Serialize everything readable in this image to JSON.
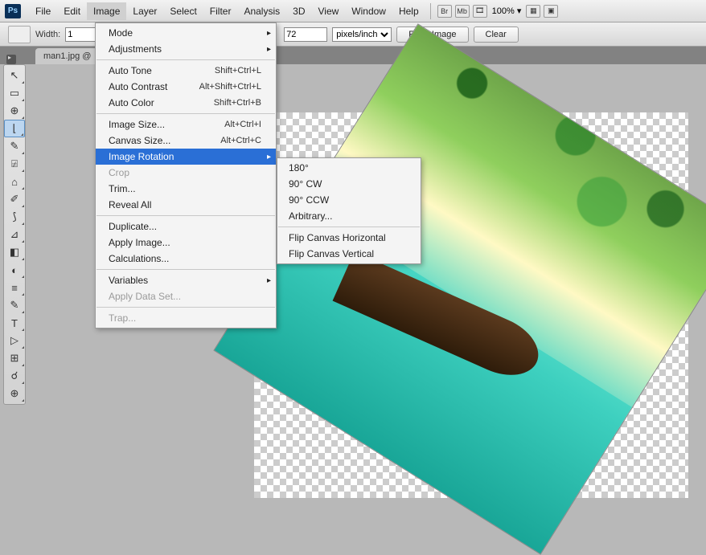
{
  "app": {
    "logo": "Ps"
  },
  "menubar": {
    "items": [
      "File",
      "Edit",
      "Image",
      "Layer",
      "Select",
      "Filter",
      "Analysis",
      "3D",
      "View",
      "Window",
      "Help"
    ],
    "active_index": 2,
    "extras": {
      "br": "Br",
      "mb": "Mb",
      "zoom": "100%  ▾"
    }
  },
  "optbar": {
    "width_label": "Width:",
    "width_value": "1",
    "res_value": "72",
    "res_unit": "pixels/inch",
    "front_image": "Front Image",
    "clear": "Clear"
  },
  "tab": {
    "label": "man1.jpg @"
  },
  "tools": {
    "items": [
      "↖",
      "▭",
      "⊕",
      "⌊",
      "✎",
      "⍯",
      "⌂",
      "✐",
      "⟆",
      "⊿",
      "◧",
      "◐",
      "≡",
      "✎",
      "T",
      "▷",
      "⊞",
      "☌",
      "⊕"
    ],
    "selected_index": 3
  },
  "image_menu": {
    "groups": [
      [
        {
          "label": "Mode",
          "arrow": true
        },
        {
          "label": "Adjustments",
          "arrow": true
        }
      ],
      [
        {
          "label": "Auto Tone",
          "short": "Shift+Ctrl+L"
        },
        {
          "label": "Auto Contrast",
          "short": "Alt+Shift+Ctrl+L"
        },
        {
          "label": "Auto Color",
          "short": "Shift+Ctrl+B"
        }
      ],
      [
        {
          "label": "Image Size...",
          "short": "Alt+Ctrl+I"
        },
        {
          "label": "Canvas Size...",
          "short": "Alt+Ctrl+C"
        },
        {
          "label": "Image Rotation",
          "arrow": true,
          "hl": true
        },
        {
          "label": "Crop",
          "disabled": true
        },
        {
          "label": "Trim..."
        },
        {
          "label": "Reveal All"
        }
      ],
      [
        {
          "label": "Duplicate..."
        },
        {
          "label": "Apply Image..."
        },
        {
          "label": "Calculations..."
        }
      ],
      [
        {
          "label": "Variables",
          "arrow": true
        },
        {
          "label": "Apply Data Set...",
          "disabled": true
        }
      ],
      [
        {
          "label": "Trap...",
          "disabled": true
        }
      ]
    ]
  },
  "rotation_submenu": {
    "groups": [
      [
        {
          "label": "180°"
        },
        {
          "label": "90° CW"
        },
        {
          "label": "90° CCW"
        },
        {
          "label": "Arbitrary..."
        }
      ],
      [
        {
          "label": "Flip Canvas Horizontal"
        },
        {
          "label": "Flip Canvas Vertical"
        }
      ]
    ]
  }
}
